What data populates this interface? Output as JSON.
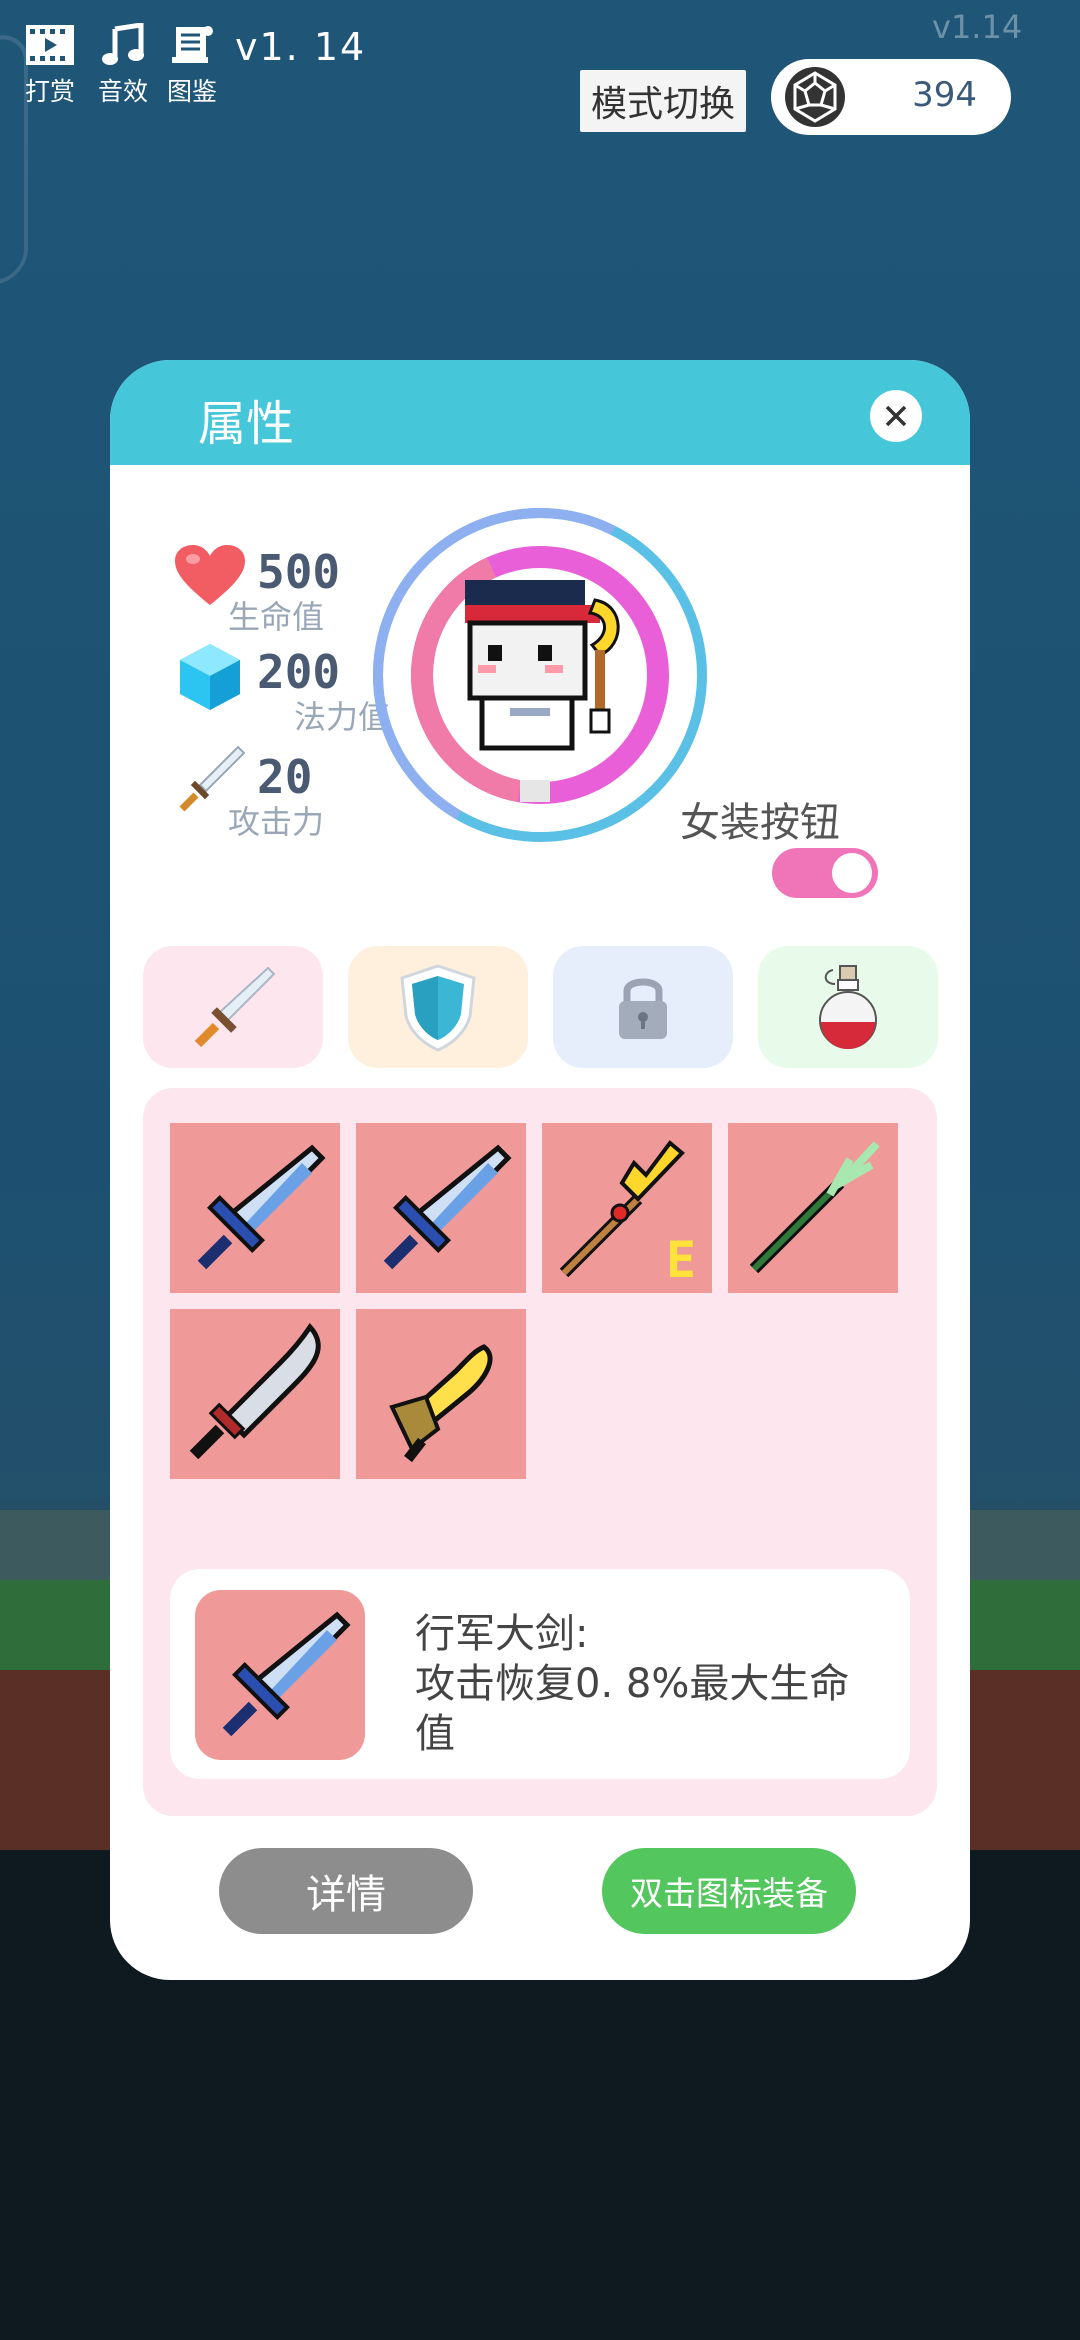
{
  "topbar": {
    "reward_label": "打赏",
    "sound_label": "音效",
    "codex_label": "图鉴",
    "version": "v1. 14",
    "version_faint": "v1.14",
    "mode_switch_label": "模式切换",
    "gem_count": "394"
  },
  "panel": {
    "title": "属性",
    "stats": {
      "hp_value": "500",
      "hp_label": "生命值",
      "mp_value": "200",
      "mp_label": "法力值",
      "atk_value": "20",
      "atk_label": "攻击力"
    },
    "dress_toggle_label": "女装按钮",
    "dress_toggle_on": true,
    "tabs": [
      "weapon",
      "shield",
      "locked",
      "potion"
    ],
    "inventory": [
      {
        "item": "broadsword",
        "grade": ""
      },
      {
        "item": "broadsword",
        "grade": ""
      },
      {
        "item": "golden-staff",
        "grade": "E"
      },
      {
        "item": "green-staff",
        "grade": ""
      },
      {
        "item": "curved-sword",
        "grade": ""
      },
      {
        "item": "golden-dagger",
        "grade": ""
      }
    ],
    "selected": {
      "name": "行军大剑:",
      "effect": "攻击恢复0. 8%最大生命值"
    },
    "detail_button": "详情",
    "equip_button": "双击图标装备"
  },
  "colors": {
    "header": "#45c6d9",
    "slot": "#ef9a99",
    "toggle": "#f075b8",
    "equip": "#54c65e"
  }
}
